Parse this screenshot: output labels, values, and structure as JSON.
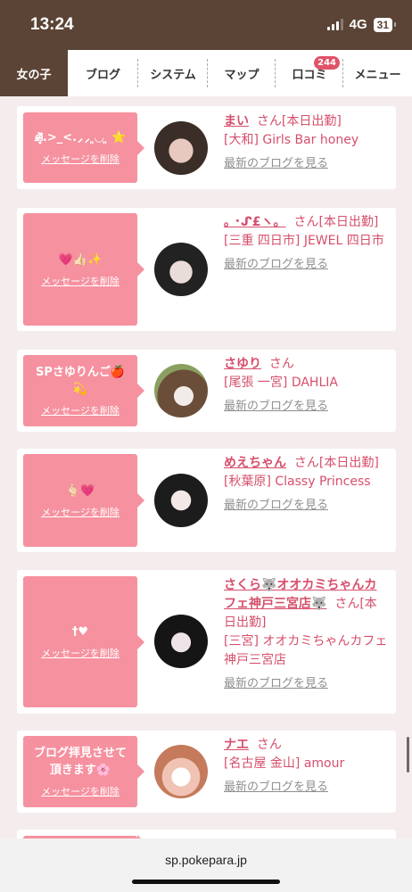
{
  "status": {
    "time": "13:24",
    "network": "4G",
    "battery": "31"
  },
  "nav": {
    "tabs": [
      {
        "label": "女の子",
        "active": true
      },
      {
        "label": "ブログ"
      },
      {
        "label": "システム"
      },
      {
        "label": "マップ"
      },
      {
        "label": "口コミ",
        "badge": "244"
      },
      {
        "label": "メニュー"
      }
    ]
  },
  "cards": [
    {
      "message": "ഒ̶̷̥᷅.>_<.⸝⸝ ͈◡ ͈ ⭐️",
      "delete_label": "メッセージを削除",
      "name": "まい",
      "san": "さん",
      "status_tag": "[本日出勤]",
      "area_shop": "[大和] Girls Bar honey",
      "blog_link": "最新のブログを見る"
    },
    {
      "message": "💗👍🏻✨",
      "delete_label": "メッセージを削除",
      "name": "｡ ･ᔑ£ヽ。",
      "san": "さん",
      "status_tag": "[本日出勤]",
      "area_shop": "[三重 四日市] JEWEL 四日市",
      "blog_link": "最新のブログを見る"
    },
    {
      "message": "SPさゆりんご🍎💫",
      "delete_label": "メッセージを削除",
      "name": "さゆり",
      "san": "さん",
      "status_tag": "",
      "area_shop": "[尾張 一宮] DAHLIA",
      "blog_link": "最新のブログを見る"
    },
    {
      "message": "🫰🏻💗",
      "delete_label": "メッセージを削除",
      "name": "めえちゃん",
      "san": "さん",
      "status_tag": "[本日出勤]",
      "area_shop": "[秋葉原] Classy Princess",
      "blog_link": "最新のブログを見る"
    },
    {
      "message": "†♥",
      "delete_label": "メッセージを削除",
      "name": "さくら🐺オオカミちゃんカフェ神戸三宮店🐺",
      "san": "さん",
      "status_tag": "[本日出勤]",
      "area_shop": "[三宮] オオカミちゃんカフェ神戸三宮店",
      "blog_link": "最新のブログを見る"
    },
    {
      "message": "ブログ拝見させて頂きます🌸",
      "delete_label": "メッセージを削除",
      "name": "ナエ",
      "san": "さん",
      "status_tag": "",
      "area_shop": "[名古屋 金山] amour",
      "blog_link": "最新のブログを見る"
    }
  ],
  "browser": {
    "url": "sp.pokepara.jp"
  },
  "colors": {
    "brown": "#5b4435",
    "pink": "#f6919f",
    "name_pink": "#d64f6b",
    "badge_red": "#e05366"
  }
}
